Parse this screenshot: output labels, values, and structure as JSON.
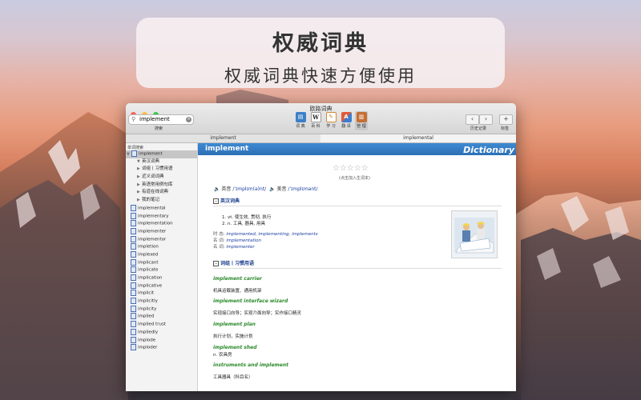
{
  "banner": {
    "title": "权威词典",
    "subtitle": "权威词典快速方便使用"
  },
  "window": {
    "title": "欧路词典",
    "search": {
      "value": "implement",
      "label": "搜索"
    },
    "toolbar": [
      {
        "name": "dict",
        "label": "词 典",
        "icon": "book-icon",
        "color": "#3d7fc7"
      },
      {
        "name": "wiki",
        "label": "百 科",
        "icon": "W",
        "color": "#ffffff"
      },
      {
        "name": "study",
        "label": "学 习",
        "icon": "study-icon",
        "color": "#e6a84a"
      },
      {
        "name": "translate",
        "label": "翻 译",
        "icon": "translate-icon",
        "color": "#d9533a"
      },
      {
        "name": "manage",
        "label": "管 理",
        "icon": "manage-icon",
        "color": "#d67a3a"
      }
    ],
    "history_label": "历史记录",
    "bookmark_label": "标签",
    "tabs": [
      "implement",
      "implemental"
    ],
    "sidebar": {
      "header": "单词搜索",
      "tree": [
        {
          "label": "implement",
          "level": 0,
          "type": "root",
          "selected": true
        },
        {
          "label": "英汉词典",
          "level": 1
        },
        {
          "label": "词组丨习惯用语",
          "level": 2
        },
        {
          "label": "近义词词典",
          "level": 2
        },
        {
          "label": "英语常用例句库",
          "level": 2
        },
        {
          "label": "有道在线词典",
          "level": 2
        },
        {
          "label": "我的笔记",
          "level": 2
        }
      ],
      "words": [
        "implemental",
        "implementary",
        "implementation",
        "implementer",
        "implementor",
        "impletion",
        "implexed",
        "implicant",
        "implicate",
        "implication",
        "implicative",
        "implicit",
        "implicitly",
        "implicity",
        "implied",
        "implied trust",
        "impliedly",
        "implode",
        "imploder"
      ]
    },
    "entry": {
      "word": "implement",
      "brand": "Dictionary",
      "stars": "☆☆☆☆☆",
      "stars_label": "(点击加入生词本)",
      "pron": [
        {
          "label": "英音",
          "phonetic": "/ˈɪmplɪm(ə)nt/"
        },
        {
          "label": "美音",
          "phonetic": "/ˈɪmplɪmənt/"
        }
      ],
      "section1": "英汉词典",
      "definitions": [
        "1.  vt. 使生效, 贯彻, 执行",
        "2.  n. 工具, 器具, 用具"
      ],
      "morph": [
        {
          "label": "时  态:",
          "value": "implemented, implementing, implements"
        },
        {
          "label": "名  词:",
          "value": "implementation"
        },
        {
          "label": "名  词:",
          "value": "implementer"
        }
      ],
      "section2": "词组丨习惯用语",
      "phrases": [
        {
          "phrase": "implement carrier",
          "meaning": "机具运载装置、通用机架"
        },
        {
          "phrase": "implement interface wizard",
          "meaning": "实现接口向导；实现介面向导；实作接口精灵"
        },
        {
          "phrase": "implement plan",
          "meaning": "执行计划，实施计划"
        },
        {
          "phrase": "implement shed",
          "meaning": "n. 农具房"
        },
        {
          "phrase": "instruments and implement",
          "meaning": "工具器具（科目名）"
        }
      ]
    }
  }
}
